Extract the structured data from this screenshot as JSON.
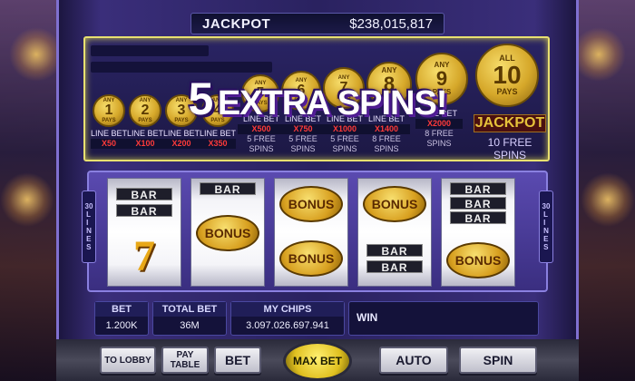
{
  "jackpot": {
    "label": "JACKPOT",
    "value": "$238,015,817"
  },
  "paytable": {
    "coins": [
      {
        "top": "ANY",
        "num": "1",
        "bottom": "PAYS"
      },
      {
        "top": "ANY",
        "num": "2",
        "bottom": "PAYS"
      },
      {
        "top": "ANY",
        "num": "3",
        "bottom": "PAYS"
      },
      {
        "top": "ANY",
        "num": "4",
        "bottom": "PAYS"
      },
      {
        "top": "ANY",
        "num": "5",
        "bottom": "PAYS"
      },
      {
        "top": "ANY",
        "num": "6",
        "bottom": "PAYS"
      },
      {
        "top": "ANY",
        "num": "7",
        "bottom": "PAYS"
      },
      {
        "top": "ANY",
        "num": "8",
        "bottom": "PAYS"
      },
      {
        "top": "ANY",
        "num": "9",
        "bottom": "PAYS"
      },
      {
        "top": "ALL",
        "num": "10",
        "bottom": "PAYS"
      }
    ],
    "payouts": [
      {
        "line": "LINE BET",
        "mult": "X50",
        "spins": ""
      },
      {
        "line": "LINE BET",
        "mult": "X100",
        "spins": ""
      },
      {
        "line": "LINE BET",
        "mult": "X200",
        "spins": ""
      },
      {
        "line": "LINE BET",
        "mult": "X350",
        "spins": ""
      },
      {
        "line": "LINE BET",
        "mult": "X500",
        "spins": "5 FREE SPINS"
      },
      {
        "line": "LINE BET",
        "mult": "X750",
        "spins": "5 FREE SPINS"
      },
      {
        "line": "LINE BET",
        "mult": "X1000",
        "spins": "5 FREE SPINS"
      },
      {
        "line": "LINE BET",
        "mult": "X1400",
        "spins": "8 FREE SPINS"
      },
      {
        "line": "LINE BET",
        "mult": "X2000",
        "spins": "8 FREE SPINS"
      }
    ],
    "jackpot_label": "JACKPOT",
    "jackpot_spins": "10 FREE SPINS"
  },
  "overlay": {
    "number": "5",
    "text": "EXTRA SPINS!"
  },
  "lines": {
    "count": "30",
    "word": "LINES"
  },
  "reels": [
    [
      "BAR",
      "BAR",
      "7"
    ],
    [
      "BAR",
      "BONUS",
      ""
    ],
    [
      "BONUS",
      "BONUS",
      ""
    ],
    [
      "BONUS",
      "BAR",
      "BAR"
    ],
    [
      "BAR",
      "BAR",
      "BAR",
      "BONUS"
    ]
  ],
  "info": {
    "bet_label": "BET",
    "bet_value": "1.200K",
    "total_label": "TOTAL BET",
    "total_value": "36M",
    "chips_label": "MY CHIPS",
    "chips_value": "3.097.026.697.941",
    "win_label": "WIN"
  },
  "buttons": {
    "lobby": "TO LOBBY",
    "paytable": "PAY TABLE",
    "bet": "BET",
    "maxbet": "MAX BET",
    "auto": "AUTO",
    "spin": "SPIN"
  },
  "colors": {
    "accent_gold": "#e6c23a",
    "multiplier_red": "#ff3a3a",
    "frame_purple": "#3a2e80"
  }
}
